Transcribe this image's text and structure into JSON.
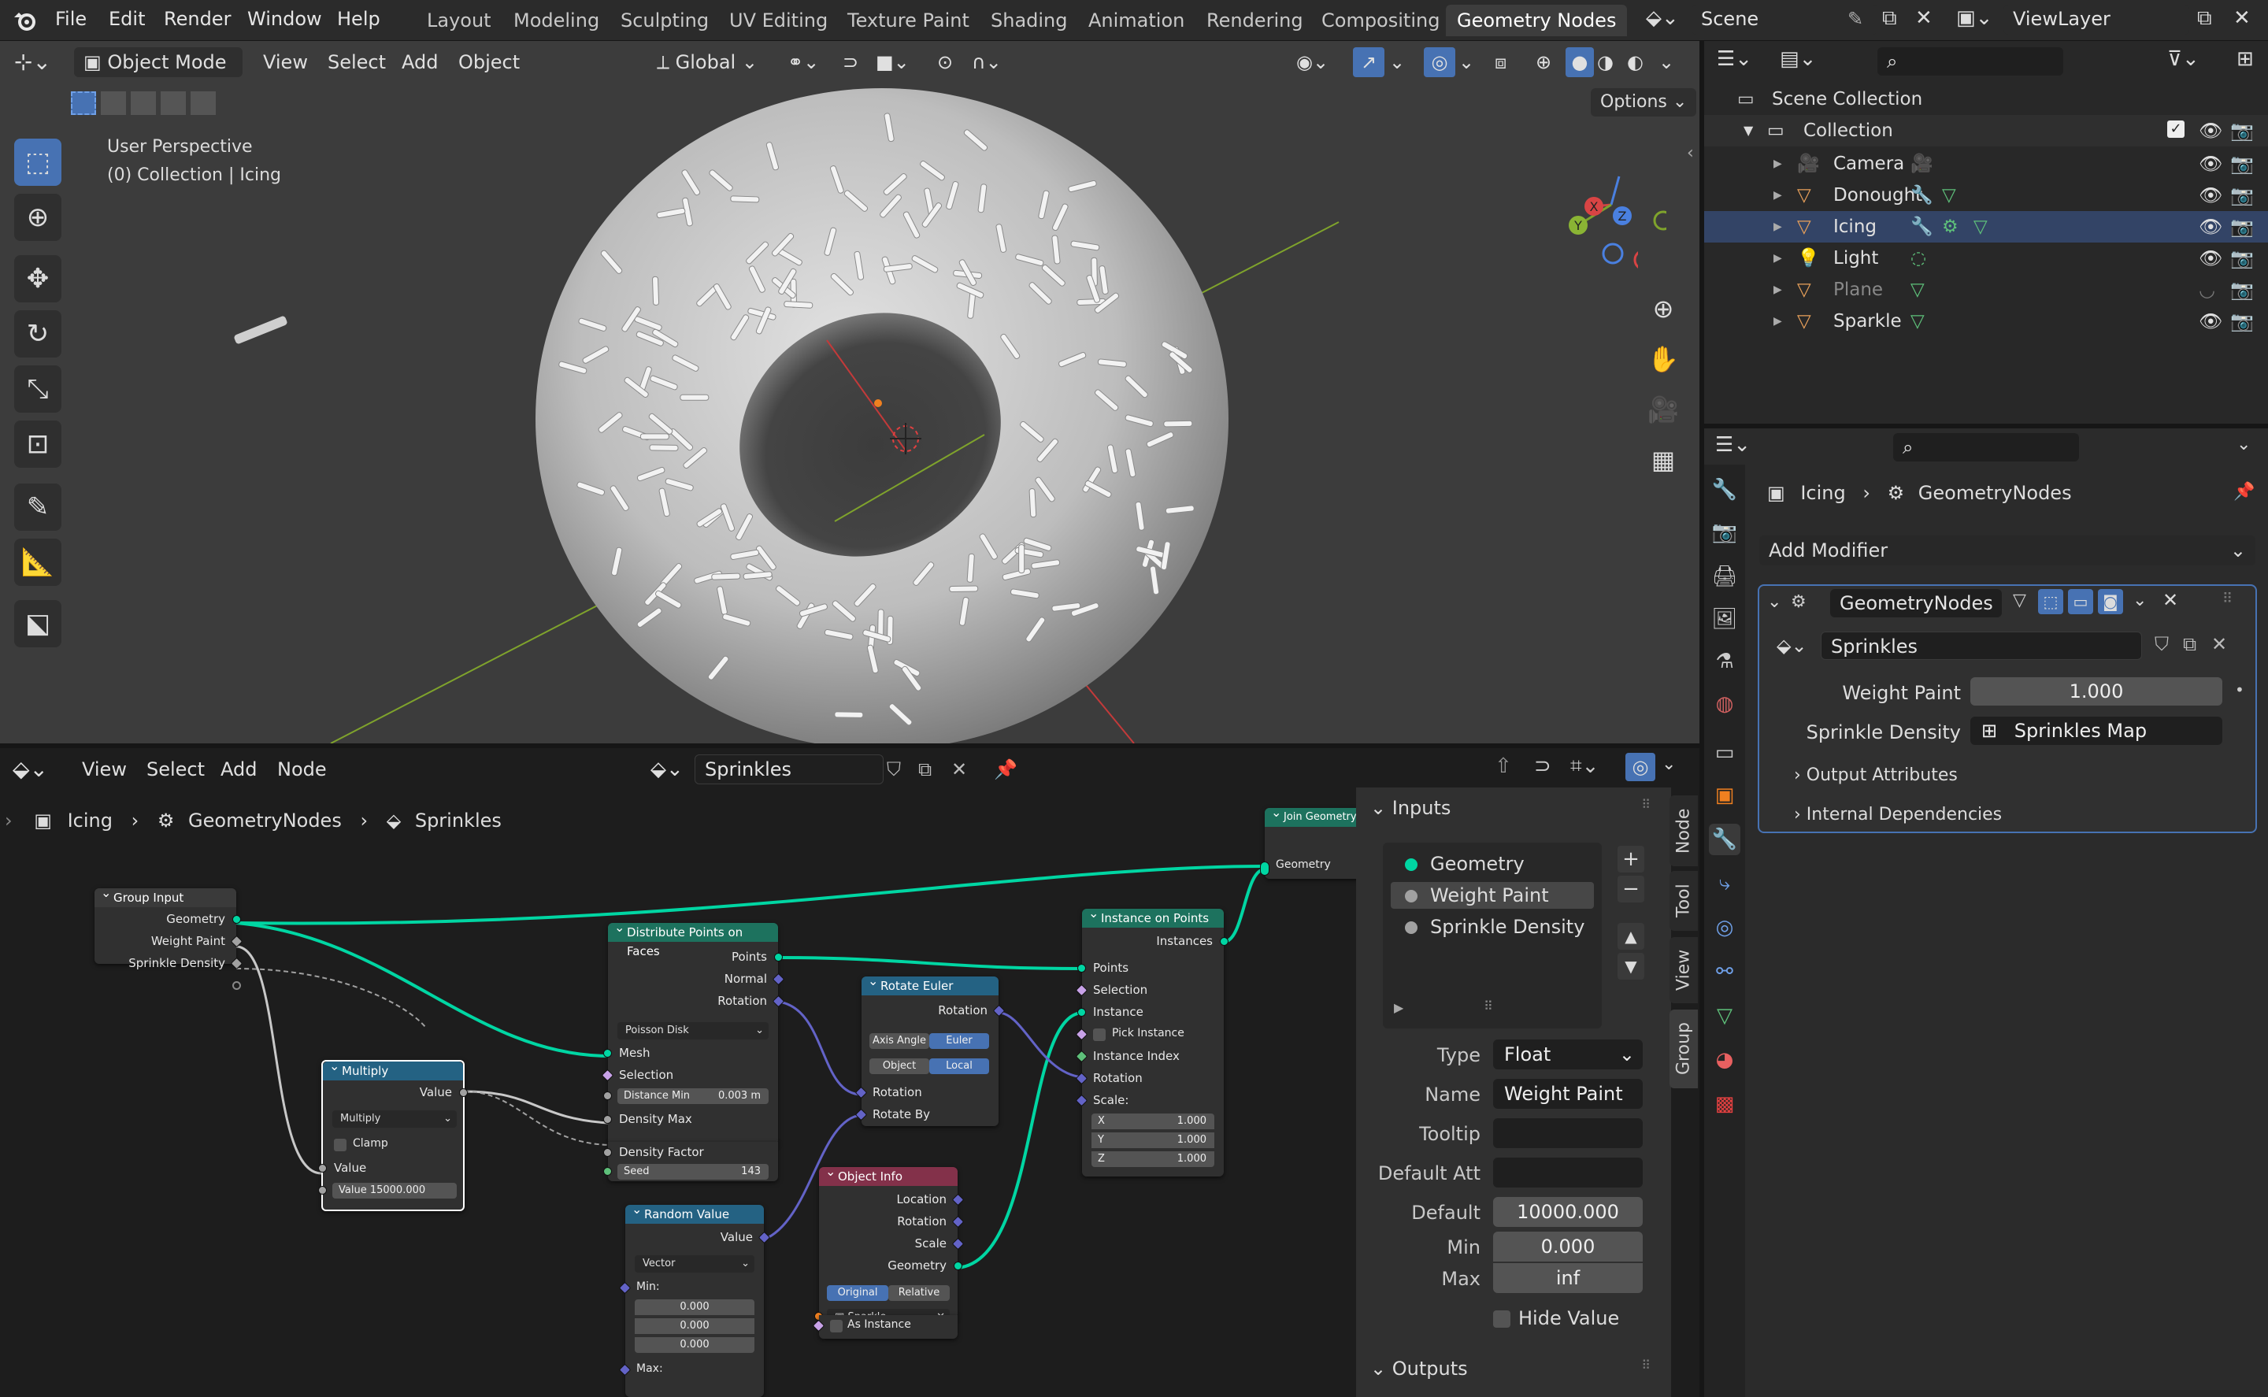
{
  "menu": [
    "File",
    "Edit",
    "Render",
    "Window",
    "Help"
  ],
  "workspaces": [
    "Layout",
    "Modeling",
    "Sculpting",
    "UV Editing",
    "Texture Paint",
    "Shading",
    "Animation",
    "Rendering",
    "Compositing",
    "Geometry Nodes"
  ],
  "scene_name": "Scene",
  "view_layer": "ViewLayer",
  "viewport": {
    "mode": "Object Mode",
    "menus": [
      "View",
      "Select",
      "Add",
      "Object"
    ],
    "transform_orientation": "Global",
    "options": "Options",
    "overlay_title": "User Perspective",
    "overlay_sub": "(0) Collection | Icing",
    "gizmo": {
      "x": "X",
      "y": "Y",
      "z": "Z"
    }
  },
  "outliner": {
    "root": "Scene Collection",
    "collection": "Collection",
    "items": [
      {
        "name": "Camera",
        "icon_color": "#e8a05a"
      },
      {
        "name": "Donought",
        "icon_color": "#e8a05a"
      },
      {
        "name": "Icing",
        "icon_color": "#e8a05a"
      },
      {
        "name": "Light",
        "icon_color": "#e8a05a"
      },
      {
        "name": "Plane",
        "icon_color": "#e8a05a"
      },
      {
        "name": "Sparkle",
        "icon_color": "#e8a05a"
      }
    ]
  },
  "properties": {
    "breadcrumb_object": "Icing",
    "breadcrumb_modifier": "GeometryNodes",
    "add_modifier": "Add Modifier",
    "modifier_name": "GeometryNodes",
    "node_group": "Sprinkles",
    "weight_paint_label": "Weight Paint",
    "weight_paint_value": "1.000",
    "sprinkle_density_label": "Sprinkle Density",
    "sprinkle_density_value": "Sprinkles Map",
    "output_attributes": "Output Attributes",
    "internal_dependencies": "Internal Dependencies"
  },
  "node_editor": {
    "menus": [
      "View",
      "Select",
      "Add",
      "Node"
    ],
    "tree_name": "Sprinkles",
    "breadcrumb": [
      "Icing",
      "GeometryNodes",
      "Sprinkles"
    ],
    "nodes": {
      "group_input": {
        "title": "Group Input",
        "outputs": [
          "Geometry",
          "Weight Paint",
          "Sprinkle Density"
        ]
      },
      "multiply": {
        "title": "Multiply",
        "out": "Value",
        "op": "Multiply",
        "clamp": "Clamp",
        "in": "Value",
        "value_label": "Value",
        "value": "15000.000"
      },
      "distribute": {
        "title": "Distribute Points on Faces",
        "outputs": [
          "Points",
          "Normal",
          "Rotation"
        ],
        "method": "Poisson Disk",
        "inputs": [
          "Mesh",
          "Selection"
        ],
        "dist_label": "Distance Min",
        "dist_value": "0.003 m",
        "inputs2": [
          "Density Max",
          "Density Factor"
        ],
        "seed_label": "Seed",
        "seed_value": "143"
      },
      "rotate": {
        "title": "Rotate Euler",
        "out": "Rotation",
        "axis_angle": "Axis Angle",
        "euler": "Euler",
        "object": "Object",
        "local": "Local",
        "inputs": [
          "Rotation",
          "Rotate By"
        ]
      },
      "random": {
        "title": "Random Value",
        "out": "Value",
        "type": "Vector",
        "min_label": "Min:",
        "min": [
          "0.000",
          "0.000",
          "0.000"
        ],
        "max_label": "Max:"
      },
      "object_info": {
        "title": "Object Info",
        "outputs": [
          "Location",
          "Rotation",
          "Scale",
          "Geometry"
        ],
        "original": "Original",
        "relative": "Relative",
        "object": "Sparkle",
        "as_instance": "As Instance"
      },
      "instance": {
        "title": "Instance on Points",
        "out": "Instances",
        "inputs": [
          "Points",
          "Selection",
          "Instance"
        ],
        "pick": "Pick Instance",
        "inputs2": [
          "Instance Index",
          "Rotation",
          "Scale:"
        ],
        "scale": [
          "1.000",
          "1.000",
          "1.000"
        ],
        "axes": [
          "X",
          "Y",
          "Z"
        ]
      },
      "join": {
        "title": "Join Geometry",
        "in": "Geometry"
      }
    },
    "tabs": [
      "Node",
      "Tool",
      "View",
      "Group"
    ],
    "panel": {
      "inputs_title": "Inputs",
      "inputs": [
        "Geometry",
        "Weight Paint",
        "Sprinkle Density"
      ],
      "type_label": "Type",
      "type_value": "Float",
      "name_label": "Name",
      "name_value": "Weight Paint",
      "tooltip_label": "Tooltip",
      "tooltip_value": "",
      "default_att_label": "Default Att",
      "default_att_value": "",
      "default_label": "Default",
      "default_value": "10000.000",
      "min_label": "Min",
      "min_value": "0.000",
      "max_label": "Max",
      "max_value": "inf",
      "hide_value": "Hide Value",
      "outputs_title": "Outputs"
    },
    "colors": {
      "geometry": "#00d6a3",
      "float": "#a1a1a1",
      "vector": "#6363c7",
      "header_geo": "#1d725e",
      "header_util": "#246283",
      "header_input": "#83314a",
      "selected": "#ffffff"
    }
  }
}
